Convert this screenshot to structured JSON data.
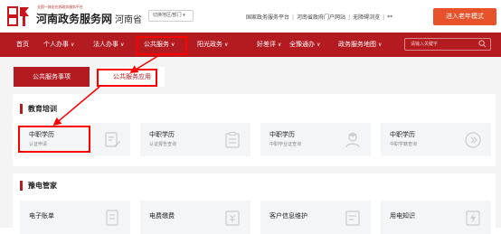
{
  "header": {
    "site_subtitle": "全国一体化在线政务服务平台",
    "site_title": "河南政务服务网",
    "province": "河南省",
    "region_select": "切换地区/部门 ▾",
    "links": [
      "国家政务服务平台",
      "河南省政府门户网站",
      "无障碍浏览",
      "**"
    ],
    "elder_button": "进入老年模式"
  },
  "nav": {
    "items": [
      {
        "label": "首页",
        "caret": ""
      },
      {
        "label": "个人办事",
        "caret": "∨"
      },
      {
        "label": "法人办事",
        "caret": "∨"
      },
      {
        "label": "公共服务",
        "caret": "∨"
      },
      {
        "label": "阳光政务",
        "caret": "∨"
      },
      {
        "label": "好差评",
        "caret": "∨"
      },
      {
        "label": "全豫通办",
        "caret": "∨"
      },
      {
        "label": "政务服务地图",
        "caret": "∨"
      }
    ],
    "search_placeholder": "请输入关键字"
  },
  "tabs": {
    "tab1": "公共服务事项",
    "tab2": "公共服务应用"
  },
  "sections": [
    {
      "title": "教育培训",
      "cards": [
        {
          "title": "中职学历",
          "subtitle": "认证申请",
          "icon": "document-edit-icon"
        },
        {
          "title": "中职学历",
          "subtitle": "认证报告查询",
          "icon": "report-icon"
        },
        {
          "title": "中职学历",
          "subtitle": "中职毕业证查询",
          "icon": "graduate-icon"
        },
        {
          "title": "中职学历",
          "subtitle": "中职学籍查询",
          "icon": "record-icon"
        }
      ]
    },
    {
      "title": "豫电管家",
      "cards": [
        {
          "title": "电子账单",
          "subtitle": "",
          "icon": "bill-icon"
        },
        {
          "title": "电费缴费",
          "subtitle": "",
          "icon": "payment-icon"
        },
        {
          "title": "客户信息维护",
          "subtitle": "",
          "icon": "user-info-icon"
        },
        {
          "title": "用电知识",
          "subtitle": "",
          "icon": "knowledge-icon"
        }
      ]
    }
  ],
  "colors": {
    "brand_red": "#b41b21",
    "elder_orange": "#e8522a",
    "annotation_red": "#ff0000"
  }
}
